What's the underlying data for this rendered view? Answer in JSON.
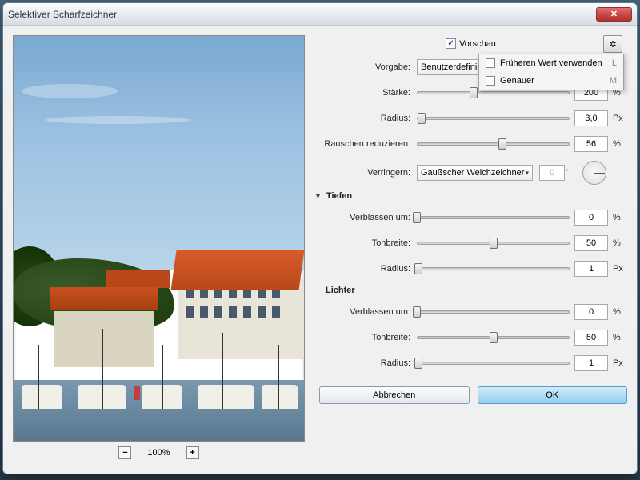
{
  "title": "Selektiver Scharfzeichner",
  "preview_label": "Vorschau",
  "preset": {
    "label": "Vorgabe:",
    "value": "Benutzerdefiniert"
  },
  "strength": {
    "label": "Stärke:",
    "value": "200",
    "unit": "%",
    "pos": 37
  },
  "radius": {
    "label": "Radius:",
    "value": "3,0",
    "unit": "Px",
    "pos": 3
  },
  "noise": {
    "label": "Rauschen reduzieren:",
    "value": "56",
    "unit": "%",
    "pos": 56
  },
  "reduce": {
    "label": "Verringern:",
    "value": "Gaußscher Weichzeichner",
    "angle": "0"
  },
  "popup": {
    "item1": "Früheren Wert verwenden",
    "item1_short": "L",
    "item2": "Genauer",
    "item2_short": "M"
  },
  "shadows": {
    "header": "Tiefen",
    "fade": {
      "label": "Verblassen um:",
      "value": "0",
      "unit": "%",
      "pos": 0
    },
    "width": {
      "label": "Tonbreite:",
      "value": "50",
      "unit": "%",
      "pos": 50
    },
    "radius": {
      "label": "Radius:",
      "value": "1",
      "unit": "Px",
      "pos": 1
    }
  },
  "highlights": {
    "header": "Lichter",
    "fade": {
      "label": "Verblassen um:",
      "value": "0",
      "unit": "%",
      "pos": 0
    },
    "width": {
      "label": "Tonbreite:",
      "value": "50",
      "unit": "%",
      "pos": 50
    },
    "radius": {
      "label": "Radius:",
      "value": "1",
      "unit": "Px",
      "pos": 1
    }
  },
  "zoom": "100%",
  "buttons": {
    "cancel": "Abbrechen",
    "ok": "OK"
  },
  "degree": "°"
}
